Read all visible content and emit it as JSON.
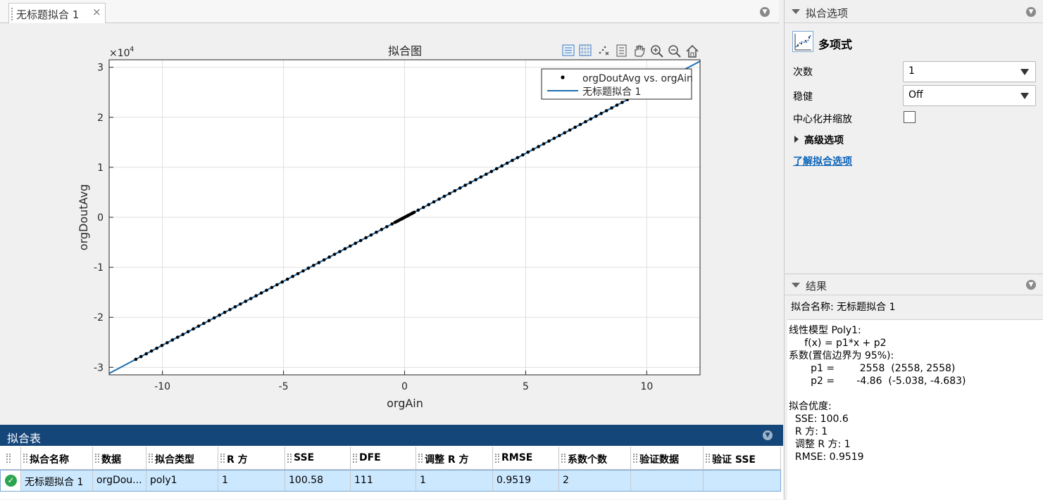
{
  "document": {
    "tab_label": "无标题拟合 1",
    "tab_close": "×"
  },
  "plot": {
    "title": "拟合图",
    "exponent_label": "×10",
    "exponent_power": "4",
    "toolbar_icons": [
      "legend-toggle-icon",
      "grid-toggle-icon",
      "exclude-outliers-icon",
      "data-cursor-icon",
      "pan-icon",
      "zoom-in-icon",
      "zoom-out-icon",
      "home-icon"
    ],
    "legend": [
      {
        "label": "orgDoutAvg vs. orgAin",
        "marker": "dot"
      },
      {
        "label": "无标题拟合 1",
        "marker": "line"
      }
    ]
  },
  "chart_data": {
    "type": "scatter",
    "title": "拟合图",
    "xlabel": "orgAin",
    "ylabel": "orgDoutAvg",
    "xlim": [
      -12.2,
      12.2
    ],
    "ylim": [
      -31500,
      31500
    ],
    "xticks": [
      -10,
      -5,
      0,
      5,
      10
    ],
    "yticks": [
      -3,
      -2,
      -1,
      0,
      1,
      2,
      3
    ],
    "y_multiplier": 10000,
    "grid": true,
    "legend_position": "top-right",
    "series": [
      {
        "name": "orgDoutAvg vs. orgAin",
        "kind": "points",
        "color": "#000000",
        "x_start": -11.1,
        "x_end": 9.2,
        "count": 111,
        "dense_near": 0
      },
      {
        "name": "无标题拟合 1",
        "kind": "fit-line",
        "color": "#1f6fb0",
        "p1": 2558,
        "p2": -4.86
      }
    ]
  },
  "fit_options": {
    "title": "拟合选项",
    "model_name": "多项式",
    "degree_label": "次数",
    "degree_value": "1",
    "robust_label": "稳健",
    "robust_value": "Off",
    "center_label": "中心化并缩放",
    "advanced_label": "高级选项",
    "help_link": "了解拟合选项"
  },
  "results": {
    "title": "结果",
    "fit_name_line": "拟合名称: 无标题拟合 1",
    "lines": [
      "线性模型 Poly1:",
      "     f(x) = p1*x + p2",
      "系数(置信边界为 95%):",
      "       p1 =        2558  (2558, 2558)",
      "       p2 =       -4.86  (-5.038, -4.683)",
      "",
      "拟合优度:",
      "  SSE: 100.6",
      "  R 方: 1",
      "  调整 R 方: 1",
      "  RMSE: 0.9519"
    ]
  },
  "fit_table": {
    "title": "拟合表",
    "columns": [
      "拟合名称",
      "数据",
      "拟合类型",
      "R 方",
      "SSE",
      "DFE",
      "调整 R 方",
      "RMSE",
      "系数个数",
      "验证数据",
      "验证 SSE"
    ],
    "rows": [
      [
        "无标题拟合 1",
        "orgDou...",
        "poly1",
        "1",
        "100.58",
        "111",
        "1",
        "0.9519",
        "2",
        "",
        ""
      ]
    ]
  }
}
